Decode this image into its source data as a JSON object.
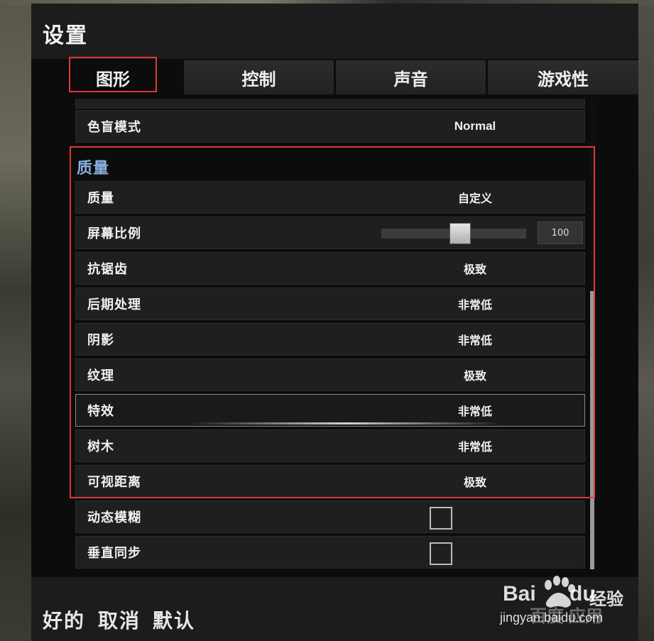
{
  "window": {
    "title": "设置"
  },
  "tabs": [
    {
      "label": "图形",
      "active": true
    },
    {
      "label": "控制",
      "active": false
    },
    {
      "label": "声音",
      "active": false
    },
    {
      "label": "游戏性",
      "active": false
    }
  ],
  "settings": {
    "colorblind": {
      "label": "色盲模式",
      "value": "Normal"
    },
    "section_title": "质量",
    "quality": {
      "label": "质量",
      "value": "自定义"
    },
    "screen_scale": {
      "label": "屏幕比例",
      "value": "100",
      "level": 0.55
    },
    "antialiasing": {
      "label": "抗锯齿",
      "value": "极致"
    },
    "postprocess": {
      "label": "后期处理",
      "value": "非常低"
    },
    "shadows": {
      "label": "阴影",
      "value": "非常低"
    },
    "textures": {
      "label": "纹理",
      "value": "极致"
    },
    "effects": {
      "label": "特效",
      "value": "非常低"
    },
    "foliage": {
      "label": "树木",
      "value": "非常低"
    },
    "view_distance": {
      "label": "可视距离",
      "value": "极致"
    },
    "motion_blur": {
      "label": "动态模糊",
      "checked": false
    },
    "vsync": {
      "label": "垂直同步",
      "checked": false
    }
  },
  "footer": {
    "ok": "好的",
    "cancel": "取消",
    "default": "默认"
  },
  "watermark": {
    "brand": "Bai",
    "brand2": "du",
    "suffix": "经验",
    "app": "百度 应用",
    "url": "jingyan.baidu.com"
  },
  "colors": {
    "section_accent": "#8ab0e0",
    "highlight_box": "#e0393b"
  }
}
